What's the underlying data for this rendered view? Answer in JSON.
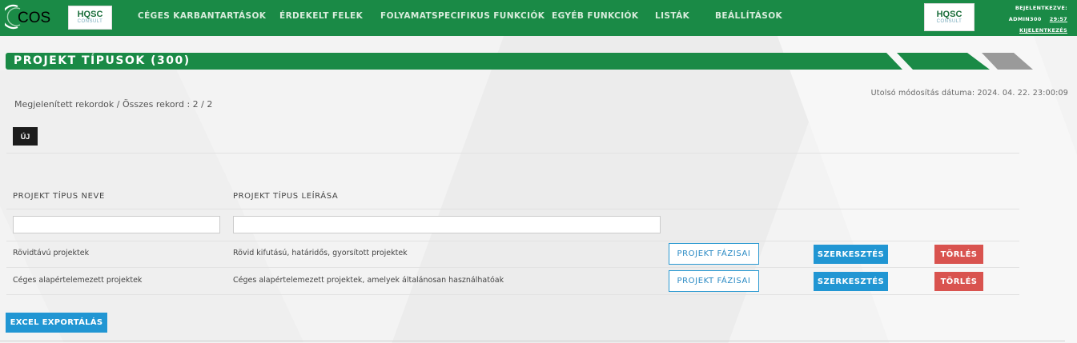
{
  "header": {
    "logo_text": "COS",
    "hqsc_text": "HQSC",
    "hqsc_sub": "CONSULT",
    "nav": [
      "CÉGES KARBANTARTÁSOK",
      "ÉRDEKELT FELEK",
      "FOLYAMATSPECIFIKUS FUNKCIÓK",
      "EGYÉB FUNKCIÓK",
      "LISTÁK",
      "BEÁLLÍTÁSOK"
    ],
    "user": {
      "logged_in_label": "BEJELENTKEZVE:",
      "username": "ADMIN300",
      "timer": "29:57",
      "logout": "KIJELENTKEZÉS"
    }
  },
  "page": {
    "title": "PROJEKT TÍPUSOK (300)",
    "last_modified": "Utolsó módosítás dátuma: 2024. 04. 22. 23:00:09",
    "record_count": "Megjelenített rekordok / Összes rekord : 2 / 2",
    "new_button": "ÚJ",
    "export_button": "EXCEL EXPORTÁLÁS"
  },
  "table": {
    "columns": [
      "PROJEKT TÍPUS NEVE",
      "PROJEKT TÍPUS LEÍRÁSA"
    ],
    "filters": [
      "",
      ""
    ],
    "rows": [
      {
        "name": "Rövidtávú projektek",
        "description": "Rövid kifutású, határidős, gyorsított projektek",
        "phase_button": "PROJEKT FÁZISAI",
        "edit_button": "SZERKESZTÉS",
        "delete_button": "TÖRLÉS"
      },
      {
        "name": "Céges alapértelemezett projektek",
        "description": "Céges alapértelemezett projektek, amelyek általánosan használhatóak",
        "phase_button": "PROJEKT FÁZISAI",
        "edit_button": "SZERKESZTÉS",
        "delete_button": "TÖRLÉS"
      }
    ]
  },
  "colors": {
    "brand_green": "#1a8a46",
    "edit_blue": "#2196d3",
    "delete_red": "#d9534f",
    "dark_button": "#1c1c1c"
  }
}
